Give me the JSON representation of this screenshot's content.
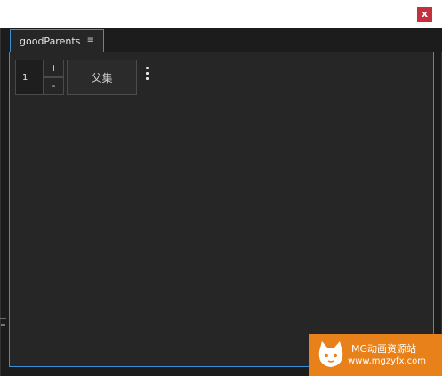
{
  "window": {
    "close_label": "x"
  },
  "tab": {
    "label": "goodParents",
    "menu_glyph": "≡"
  },
  "controls": {
    "number_value": "1",
    "increment_label": "+",
    "decrement_label": "-",
    "parent_button_label": "父集"
  },
  "watermark": {
    "line1": "MG动画资源站",
    "line2": "www.mgzyfx.com"
  },
  "colors": {
    "accent_border": "#3a8fd4",
    "close_button": "#c4303c",
    "watermark_bg": "#e8811a",
    "panel_bg": "#262626"
  },
  "icons": {
    "tab_menu": "hamburger-menu-icon",
    "more": "vertical-ellipsis-icon",
    "watermark_logo": "cat-face-logo"
  }
}
